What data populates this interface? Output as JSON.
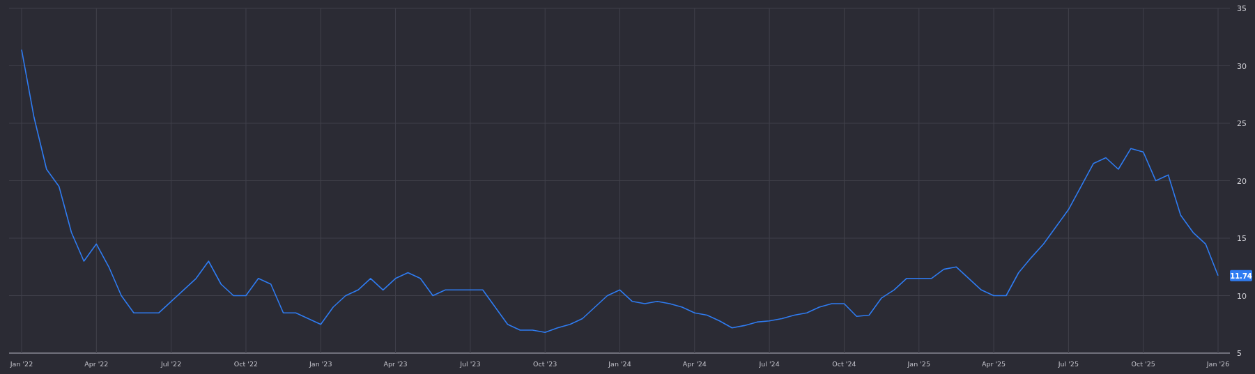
{
  "chart": {
    "chart_data": {
      "type": "line",
      "categories": [
        "Jan '22",
        null,
        null,
        null,
        null,
        null,
        "Apr '22",
        null,
        null,
        null,
        null,
        null,
        "Jul '22",
        null,
        null,
        null,
        null,
        null,
        "Oct '22",
        null,
        null,
        null,
        null,
        null,
        "Jan '23",
        null,
        null,
        null,
        null,
        null,
        "Apr '23",
        null,
        null,
        null,
        null,
        null,
        "Jul '23",
        null,
        null,
        null,
        null,
        null,
        "Oct '23",
        null,
        null,
        null,
        null,
        null,
        "Jan '24",
        null,
        null,
        null,
        null,
        null,
        "Apr '24",
        null,
        null,
        null,
        null,
        null,
        "Jul '24",
        null,
        null,
        null,
        null,
        null,
        "Oct '24",
        null,
        null,
        null,
        null,
        null,
        "Jan '25",
        null,
        null,
        null,
        null,
        null,
        "Apr '25",
        null,
        null,
        null,
        null,
        null,
        "Jul '25",
        null,
        null,
        null,
        null,
        null,
        "Oct '25",
        null,
        null,
        null,
        null,
        null,
        "Jan '26"
      ],
      "series": [
        {
          "color": "#2f7cf2",
          "values": [
            31.4,
            25.5,
            21,
            19.5,
            15.5,
            13,
            14.5,
            12.5,
            10,
            8.5,
            8.5,
            8.5,
            9.5,
            10.5,
            11.5,
            13,
            11,
            10,
            10,
            11.5,
            11,
            8.5,
            8.5,
            8,
            7.5,
            9,
            10,
            10.5,
            11.5,
            10.5,
            11.5,
            12,
            11.5,
            10,
            10.5,
            10.5,
            10.5,
            10.5,
            9,
            7.5,
            7,
            7,
            6.8,
            7.2,
            7.5,
            8,
            9,
            10,
            10.5,
            9.5,
            9.3,
            9.5,
            9.3,
            9,
            8.5,
            8.3,
            7.8,
            7.2,
            7.4,
            7.7,
            7.8,
            8,
            8.3,
            8.5,
            9,
            9.3,
            9.3,
            8.2,
            8.3,
            9.8,
            10.5,
            11.5,
            11.5,
            11.5,
            12.3,
            12.5,
            11.5,
            10.5,
            10,
            10,
            12,
            13.3,
            14.5,
            16,
            17.5,
            19.5,
            21.5,
            22,
            21,
            22.8,
            22.5,
            20,
            20.5,
            17,
            15.5,
            14.5,
            11.74
          ]
        }
      ],
      "ylim": [
        5,
        35
      ],
      "grid": true,
      "yticks": [
        5,
        10,
        15,
        20,
        25,
        30,
        35
      ]
    },
    "last_value_badge": "11.74"
  }
}
